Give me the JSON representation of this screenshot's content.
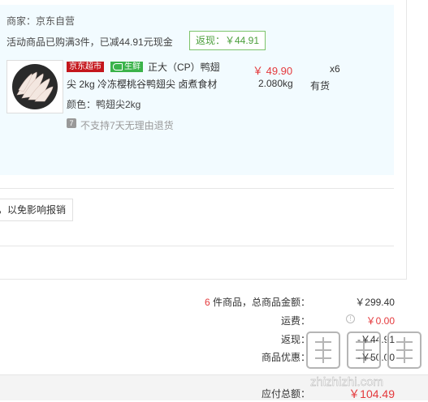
{
  "order": {
    "merchant": "商家：京东自营",
    "promo_text": "活动商品已购满3件，已减44.91元现金",
    "rebate_tag": "返现：￥44.91",
    "item": {
      "badge_jd": "京东超市",
      "badge_fresh": "生鲜",
      "title_line1": "正大（CP）鸭翅",
      "title_line2": "尖 2kg 冷冻樱桃谷鸭翅尖 卤煮食材",
      "price": "￥ 49.90",
      "quantity": "x6",
      "weight": "2.080kg",
      "stock": "有货",
      "spec": "颜色：鸭翅尖2kg",
      "return_badge": "7",
      "return_policy": "不支持7天无理由退货"
    }
  },
  "invoice_tip": "，以免影响报销",
  "summary": {
    "count": "6",
    "count_label": "件商品，总商品金额：",
    "goods_total": "￥299.40",
    "shipping_label": "运费：",
    "shipping_value": "￥0.00",
    "rebate_label": "返现：",
    "rebate_value": "-￥44.91",
    "discount_label": "商品优惠：",
    "discount_value": "-￥50.00",
    "payable_label": "应付总额：",
    "payable_value": "￥104.49"
  },
  "watermark_text": "zhizhizhi.com",
  "colors": {
    "accent_red": "#e4393c",
    "rebate_green": "#4a9e3a",
    "shop_bg": "#f2fbff"
  }
}
